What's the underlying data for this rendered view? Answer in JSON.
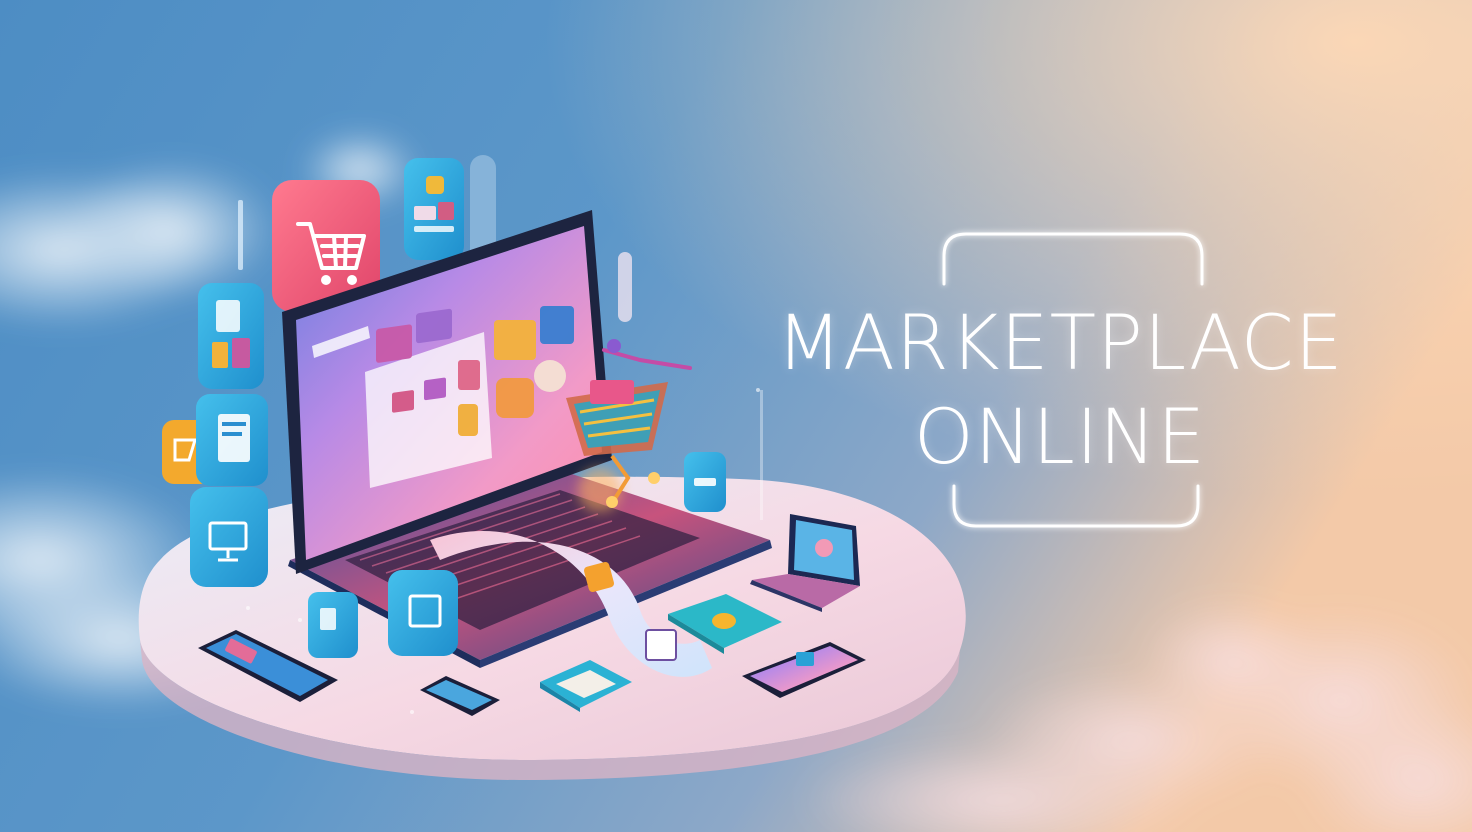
{
  "headline": {
    "line1": "MARKETPLACE",
    "line2": "ONLINE"
  },
  "colors": {
    "sky_top_left": "#5e9ccd",
    "sky_right_warm": "#f1c6a6",
    "frame_glow": "#ffffff",
    "platform": "#f3d6e2",
    "cart_tile": "#ef5b7b",
    "tile_blue": "#2ba6d8"
  },
  "icons": [
    "shopping-cart-icon",
    "monitor-icon",
    "document-icon",
    "tag-icon",
    "coin-icon",
    "smartphone-icon",
    "laptop-icon",
    "receipt-icon"
  ]
}
